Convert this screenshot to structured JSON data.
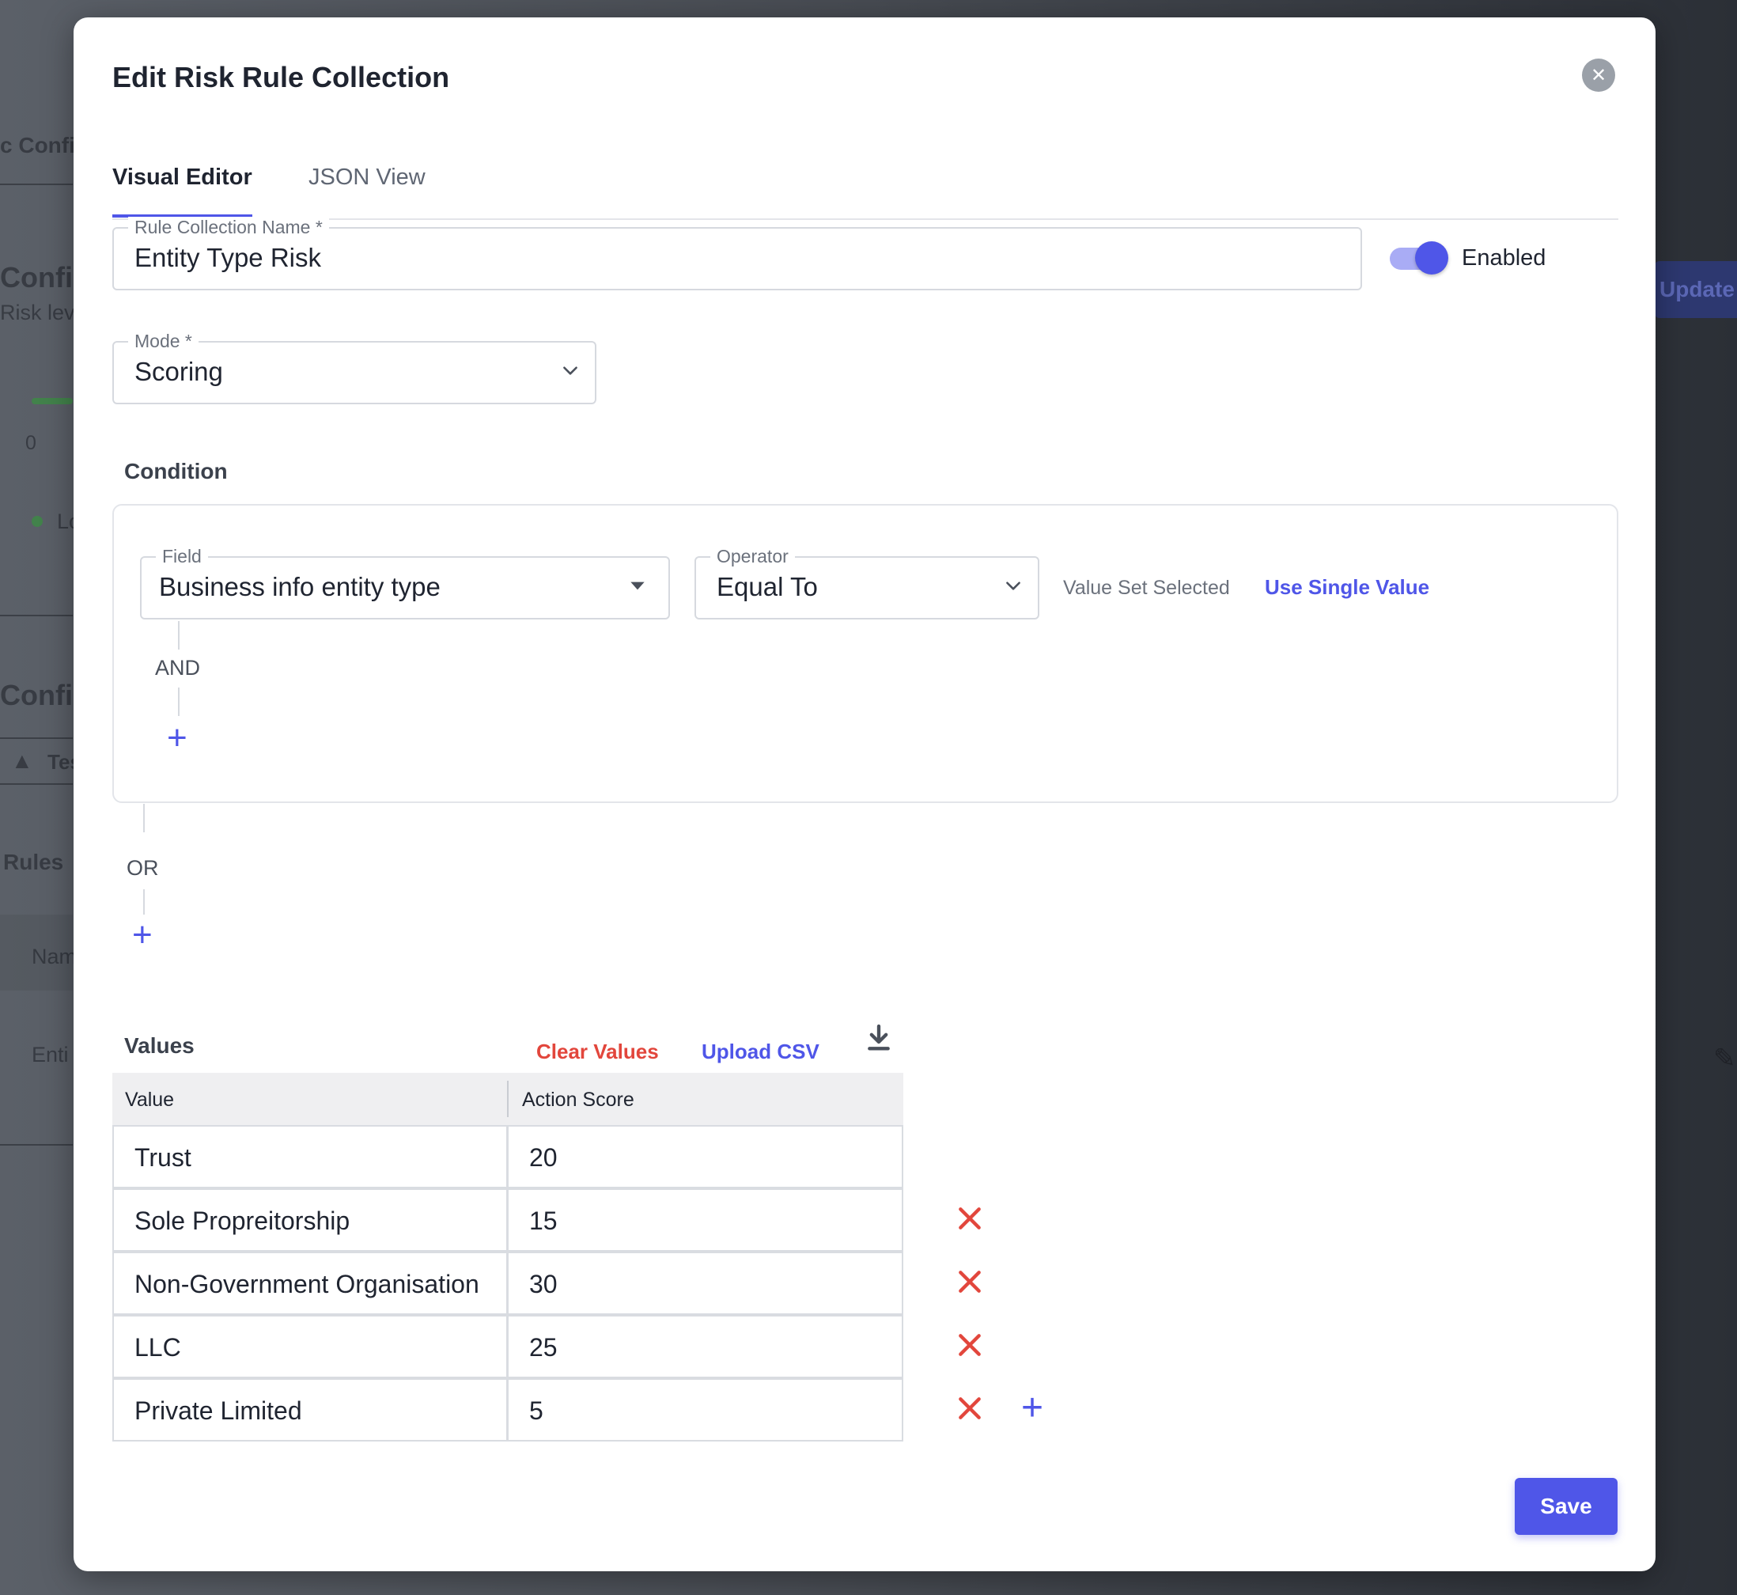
{
  "background": {
    "texts": [
      "c Confi",
      "Config",
      "Risk lev",
      "0",
      "Lo",
      "Config",
      "Tes",
      "Rules",
      "Nam",
      "Enti"
    ],
    "update_button": "Update"
  },
  "modal": {
    "title": "Edit Risk Rule Collection",
    "tabs": [
      {
        "label": "Visual Editor",
        "active": true
      },
      {
        "label": "JSON View",
        "active": false
      }
    ],
    "rule_collection_name": {
      "label": "Rule Collection Name *",
      "value": "Entity Type Risk"
    },
    "enabled_toggle": {
      "label": "Enabled",
      "on": true
    },
    "mode": {
      "label": "Mode *",
      "value": "Scoring"
    },
    "condition": {
      "label": "Condition",
      "field": {
        "label": "Field",
        "value": "Business info entity type"
      },
      "operator": {
        "label": "Operator",
        "value": "Equal To"
      },
      "value_set_hint": "Value Set Selected",
      "use_single_value": "Use Single Value",
      "and_label": "AND",
      "or_label": "OR"
    },
    "values": {
      "label": "Values",
      "clear_values": "Clear Values",
      "upload_csv": "Upload CSV",
      "columns": [
        "Value",
        "Action Score"
      ],
      "rows": [
        {
          "value": "Trust",
          "score": "20"
        },
        {
          "value": "Sole Propreitorship",
          "score": "15"
        },
        {
          "value": "Non-Government Organisation",
          "score": "30"
        },
        {
          "value": "LLC",
          "score": "25"
        },
        {
          "value": "Private Limited",
          "score": "5"
        }
      ]
    },
    "save_label": "Save"
  },
  "colors": {
    "accent": "#4f56e8",
    "danger": "#e2463c"
  }
}
